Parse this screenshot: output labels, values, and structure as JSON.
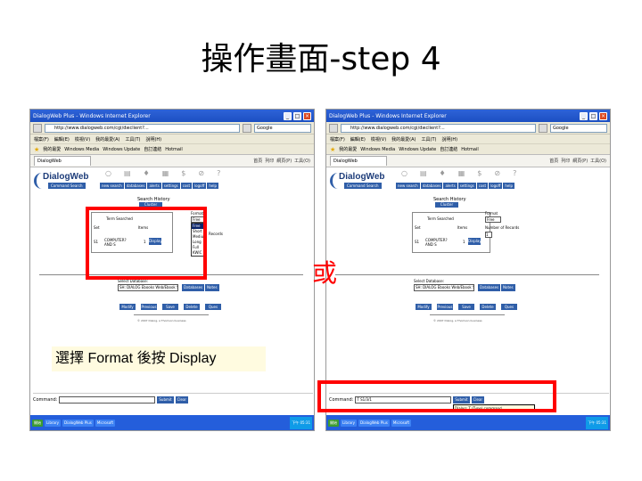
{
  "slide": {
    "title": "操作畫面-step 4",
    "or_label": "或",
    "note": "選擇 Format 後按 Display"
  },
  "browser": {
    "window_title": "DialogWeb Plus - Windows Internet Explorer",
    "address": "http://www.dialogweb.com/cgi/dwclient?...",
    "search_placeholder": "Google",
    "menu": [
      "檔案(F)",
      "編輯(E)",
      "檢視(V)",
      "我的最愛(A)",
      "工具(T)",
      "說明(H)"
    ],
    "favorites": [
      "我的最愛",
      "Windows Media",
      "Windows Update",
      "自訂連結",
      "Hotmail"
    ],
    "tab_label": "DialogWeb",
    "toolicons": [
      "首頁",
      "列印",
      "網頁(P)",
      "工具(O)"
    ]
  },
  "dialogweb": {
    "logo": "DialogWeb",
    "logo_sub": "Command Search",
    "nav": [
      "new search",
      "databases",
      "alerts",
      "settings",
      "cost",
      "logoff",
      "help"
    ],
    "panel_title": "Search History",
    "panel_sub": "Cluster Search",
    "table_headers": [
      "Set",
      "Term Searched",
      "Items"
    ],
    "row": {
      "set": "S1",
      "term": "COMPUTER? AND S",
      "items": "1"
    },
    "display_button": "Display",
    "format_label": "Format",
    "format_selected": "Free",
    "format_options": [
      "Free",
      "Short",
      "Medium",
      "Long",
      "Full",
      "KWIC"
    ],
    "records_label": "Records",
    "number_records_label": "Number of Records",
    "number_records_value": "1",
    "db_label": "Select Database:",
    "db_value": "SH: DIALOG Ebooks Web/Ebook Search",
    "db_buttons": [
      "Databases",
      "Notes"
    ],
    "bottom_buttons": [
      "Modify",
      "Previous",
      "Save",
      "Delete",
      "Ques"
    ],
    "copyright": "© 2007 Dialog, a Thomson business",
    "command_label": "Command:",
    "command_value_right": "T S1/3/1",
    "command_buttons": [
      "Submit",
      "Clear"
    ],
    "tooltip": "Dialog: T (Type) command..."
  },
  "taskbar": {
    "items_left": [
      "開始",
      "Library",
      "DialogWeb Plus",
      "Microsoft"
    ],
    "items_right": [
      "開始",
      "Library",
      "DialogWeb Plus",
      "Microsoft"
    ],
    "clock": "下午 05:31"
  },
  "colors": {
    "highlight": "#ff0000",
    "dialog_blue": "#2f5ea8",
    "xp_title": "#2e63d8"
  }
}
